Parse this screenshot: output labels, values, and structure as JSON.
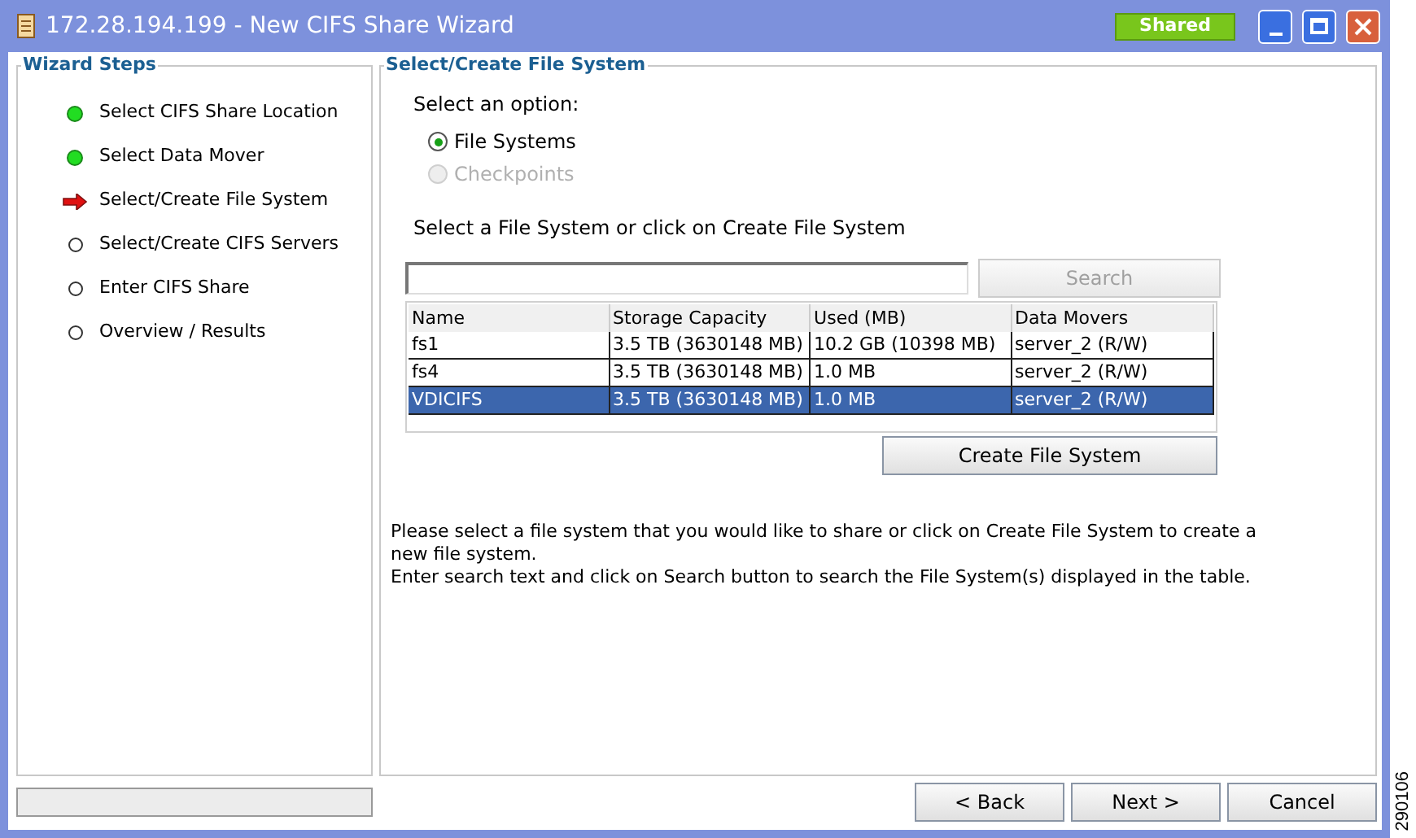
{
  "window": {
    "title": "172.28.194.199 - New CIFS Share Wizard",
    "badge": "Shared"
  },
  "steps_panel": {
    "title": "Wizard Steps",
    "steps": [
      {
        "label": "Select CIFS Share Location",
        "kind": "done"
      },
      {
        "label": "Select Data Mover",
        "kind": "done"
      },
      {
        "label": "Select/Create File System",
        "kind": "current"
      },
      {
        "label": "Select/Create CIFS Servers",
        "kind": "pending"
      },
      {
        "label": "Enter CIFS Share",
        "kind": "pending"
      },
      {
        "label": "Overview / Results",
        "kind": "pending"
      }
    ]
  },
  "main_panel": {
    "title": "Select/Create File System",
    "option_prompt": "Select an option:",
    "options": [
      {
        "label": "File Systems",
        "selected": true,
        "disabled": false
      },
      {
        "label": "Checkpoints",
        "selected": false,
        "disabled": true
      }
    ],
    "table_prompt": "Select a File System or click on Create File System",
    "search_button": {
      "label": "Search",
      "disabled": true
    },
    "table": {
      "columns": [
        "Name",
        "Storage Capacity",
        "Used (MB)",
        "Data Movers"
      ],
      "rows": [
        {
          "cells": [
            "fs1",
            "3.5 TB (3630148 MB)",
            "10.2 GB (10398 MB)",
            "server_2 (R/W)"
          ],
          "selected": false
        },
        {
          "cells": [
            "fs4",
            "3.5 TB (3630148 MB)",
            "1.0 MB",
            "server_2 (R/W)"
          ],
          "selected": false
        },
        {
          "cells": [
            "VDICIFS",
            "3.5 TB (3630148 MB)",
            "1.0 MB",
            "server_2 (R/W)"
          ],
          "selected": true
        }
      ]
    },
    "create_button": {
      "label": "Create File System"
    },
    "help_lines": [
      "Please select a file system that you would like to share or click on Create File System to create a new file system.",
      "Enter search text and click on Search button to search the File System(s) displayed in the table."
    ]
  },
  "buttons": [
    {
      "label": "< Back"
    },
    {
      "label": "Next >"
    },
    {
      "label": "Cancel"
    }
  ],
  "figure_number": "290106"
}
